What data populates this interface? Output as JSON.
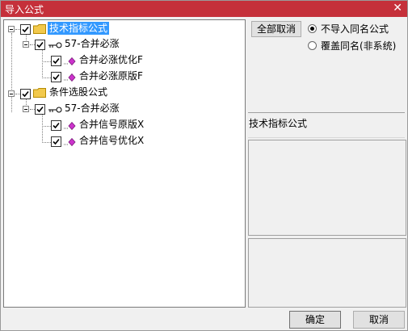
{
  "window": {
    "title": "导入公式",
    "close_glyph": "✕"
  },
  "tree": {
    "nodes": [
      {
        "label": "技术指标公式",
        "checked": true,
        "selected": true
      },
      {
        "label": "57-合并必涨",
        "checked": true
      },
      {
        "label": "合并必涨优化F",
        "checked": true
      },
      {
        "label": "合并必涨原版F",
        "checked": true
      },
      {
        "label": "条件选股公式",
        "checked": true
      },
      {
        "label": "57-合并必涨",
        "checked": true
      },
      {
        "label": "合并信号原版X",
        "checked": true
      },
      {
        "label": "合并信号优化X",
        "checked": true
      }
    ]
  },
  "options": {
    "cancel_all_label": "全部取消",
    "radio_no_import": "不导入同名公式",
    "radio_overwrite": "覆盖同名(非系统)"
  },
  "info": {
    "category_label": "技术指标公式"
  },
  "footer": {
    "ok_label": "确定",
    "cancel_label": "取消"
  },
  "colors": {
    "titlebar": "#c5303a",
    "selection": "#3399ff",
    "folder": "#f2c94c",
    "diamond": "#cc33cc"
  }
}
